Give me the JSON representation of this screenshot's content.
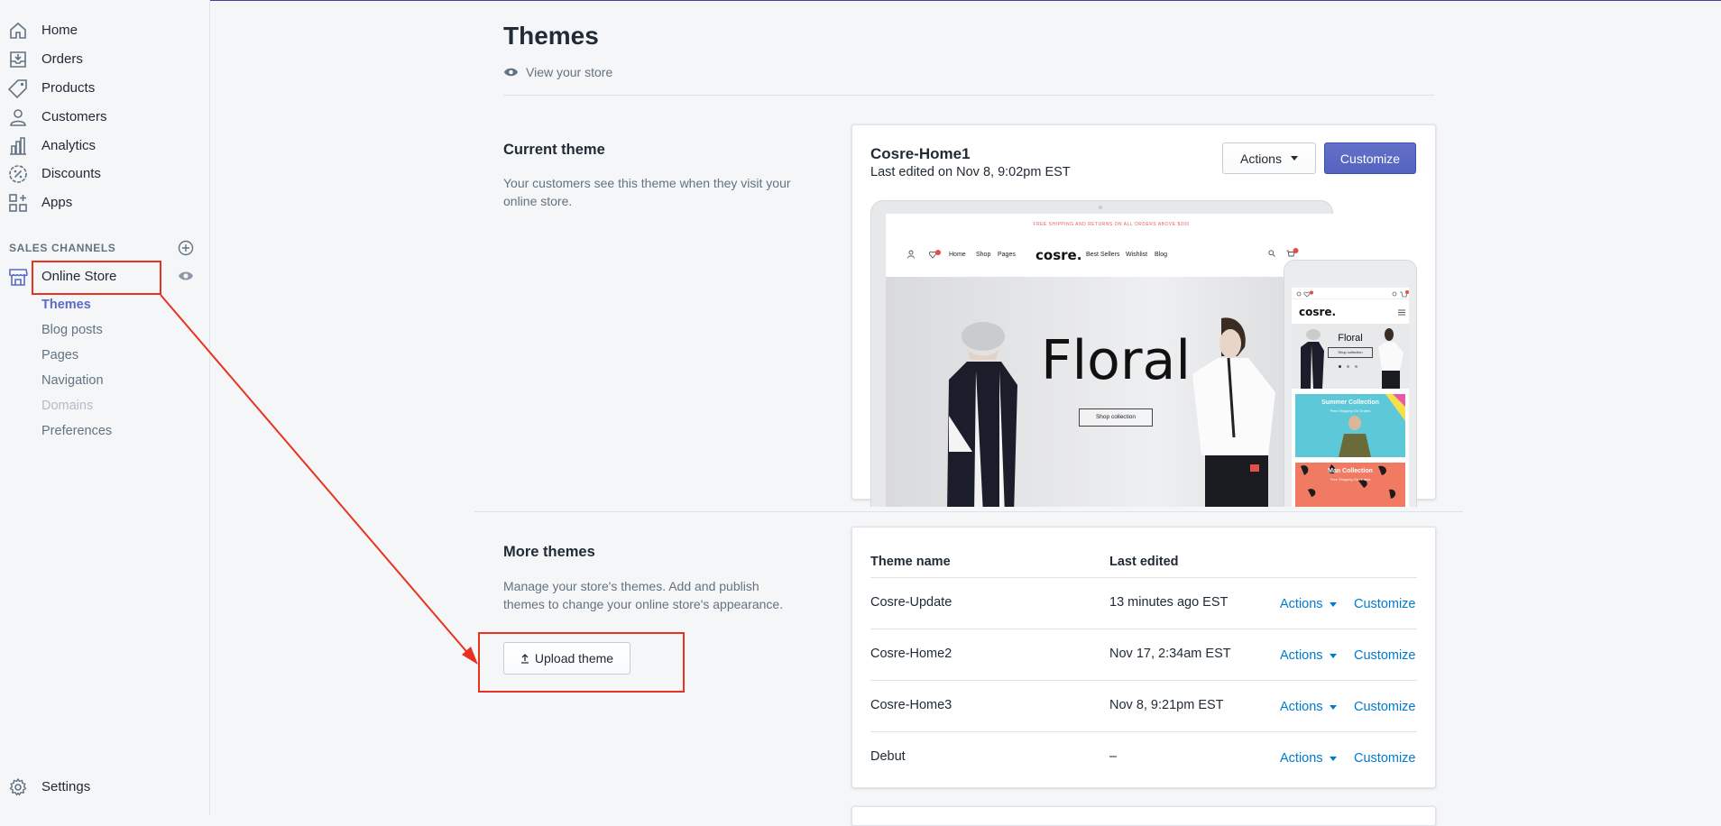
{
  "sidebar": {
    "nav": [
      {
        "label": "Home",
        "icon": "home-icon"
      },
      {
        "label": "Orders",
        "icon": "orders-icon"
      },
      {
        "label": "Products",
        "icon": "tag-icon"
      },
      {
        "label": "Customers",
        "icon": "person-icon"
      },
      {
        "label": "Analytics",
        "icon": "bar-chart-icon"
      },
      {
        "label": "Discounts",
        "icon": "discount-icon"
      },
      {
        "label": "Apps",
        "icon": "apps-icon"
      }
    ],
    "sales_channels_heading": "SALES CHANNELS",
    "online_store": {
      "label": "Online Store",
      "sub_items": [
        {
          "label": "Themes"
        },
        {
          "label": "Blog posts"
        },
        {
          "label": "Pages"
        },
        {
          "label": "Navigation"
        },
        {
          "label": "Domains"
        },
        {
          "label": "Preferences"
        }
      ]
    },
    "settings_label": "Settings"
  },
  "header": {
    "title": "Themes",
    "view_store_label": "View your store"
  },
  "current_theme": {
    "section_title": "Current theme",
    "section_description": "Your customers see this theme when they visit your online store.",
    "theme_name": "Cosre-Home1",
    "last_edited": "Last edited on Nov 8, 9:02pm EST",
    "actions_label": "Actions",
    "customize_label": "Customize",
    "preview": {
      "promo_text": "FREE SHIPPING AND RETURNS ON ALL ORDERS ABOVE $200",
      "nav_links_left": [
        "Home",
        "Shop",
        "Pages"
      ],
      "brand": "cosre.",
      "nav_links_right": [
        "Best Sellers",
        "Wishlist",
        "Blog"
      ],
      "hero_title": "Floral",
      "hero_button": "Shop collection",
      "phone_hero_title": "Floral",
      "phone_hero_button": "Shop collection",
      "phone_banner_1": "Summer Collection",
      "phone_banner_1_sub": "Free Shipping On Orders",
      "phone_banner_2": "Man Collection",
      "phone_banner_2_sub": "Free Shipping On Orders"
    }
  },
  "more_themes": {
    "section_title": "More themes",
    "section_description": "Manage your store's themes. Add and publish themes to change your online store's appearance.",
    "upload_label": "Upload theme",
    "columns": [
      "Theme name",
      "Last edited"
    ],
    "rows": [
      {
        "name": "Cosre-Update",
        "edited": "13 minutes ago EST",
        "actions": "Actions",
        "customize": "Customize"
      },
      {
        "name": "Cosre-Home2",
        "edited": "Nov 17, 2:34am EST",
        "actions": "Actions",
        "customize": "Customize"
      },
      {
        "name": "Cosre-Home3",
        "edited": "Nov 8, 9:21pm EST",
        "actions": "Actions",
        "customize": "Customize"
      },
      {
        "name": "Debut",
        "edited": "–",
        "actions": "Actions",
        "customize": "Customize"
      }
    ]
  },
  "colors": {
    "accent": "#5c6ac4",
    "link": "#007ace",
    "annotation": "#e8321f"
  }
}
